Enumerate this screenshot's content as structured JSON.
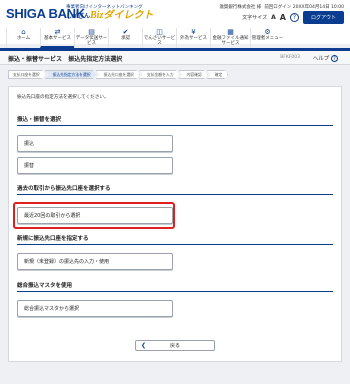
{
  "brand": {
    "bank": "SHIGA BANK",
    "tagline": "事業者向けインターネットバンキング",
    "service_name": "しがぎん",
    "biz": "Bizダイレクト"
  },
  "util": {
    "company": "滋賀銀行株式会社 様",
    "login_info": "前回ログイン 20XX年04月14日 10:00",
    "font_size_label": "文字サイズ",
    "font_small": "A",
    "font_large": "A",
    "help_mark": "?",
    "logout": "ログアウト"
  },
  "nav": [
    {
      "icon": "home-icon",
      "glyph": "⌂",
      "label": "ホーム"
    },
    {
      "icon": "transfer-icon",
      "glyph": "⇄",
      "label": "基本サービス"
    },
    {
      "icon": "data-icon",
      "glyph": "▤",
      "label": "データ伝送サービス"
    },
    {
      "icon": "approve-icon",
      "glyph": "✔",
      "label": "承認"
    },
    {
      "icon": "digital-icon",
      "glyph": "◫",
      "label": "でんさいサービス"
    },
    {
      "icon": "fx-icon",
      "glyph": "¥",
      "label": "外為サービス"
    },
    {
      "icon": "file-icon",
      "glyph": "▦",
      "label": "金融ファイル通知サービス"
    },
    {
      "icon": "admin-icon",
      "glyph": "⚙",
      "label": "管理者メニュー"
    }
  ],
  "title": {
    "service": "振込・振替サービス",
    "page": "振込先指定方法選択",
    "screen_code": "BFKF003",
    "help": "ヘルプ"
  },
  "steps": [
    "支払口座を選択",
    "振込先指定方法を選択",
    "振込先口座を選択",
    "支払金額を入力",
    "内容確認",
    "確定"
  ],
  "intro": "振込先口座の指定方法を選択してください。",
  "sections": [
    {
      "title": "振込・振替を選択",
      "options": [
        "振込",
        "振替"
      ]
    },
    {
      "title": "過去の取引から振込先口座を選択する",
      "options": [
        "最近20回の取引から選択"
      ]
    },
    {
      "title": "新規に振込先口座を指定する",
      "options": [
        "新規（未登録）の振込先の入力・使用"
      ]
    },
    {
      "title": "総合振込マスタを使用",
      "options": [
        "総合振込マスタから選択"
      ]
    }
  ],
  "back_label": "戻る",
  "back_arrow": "❮",
  "colors": {
    "accent": "#0a3d8f",
    "highlight": "#e02020",
    "gold": "#e0a400"
  }
}
